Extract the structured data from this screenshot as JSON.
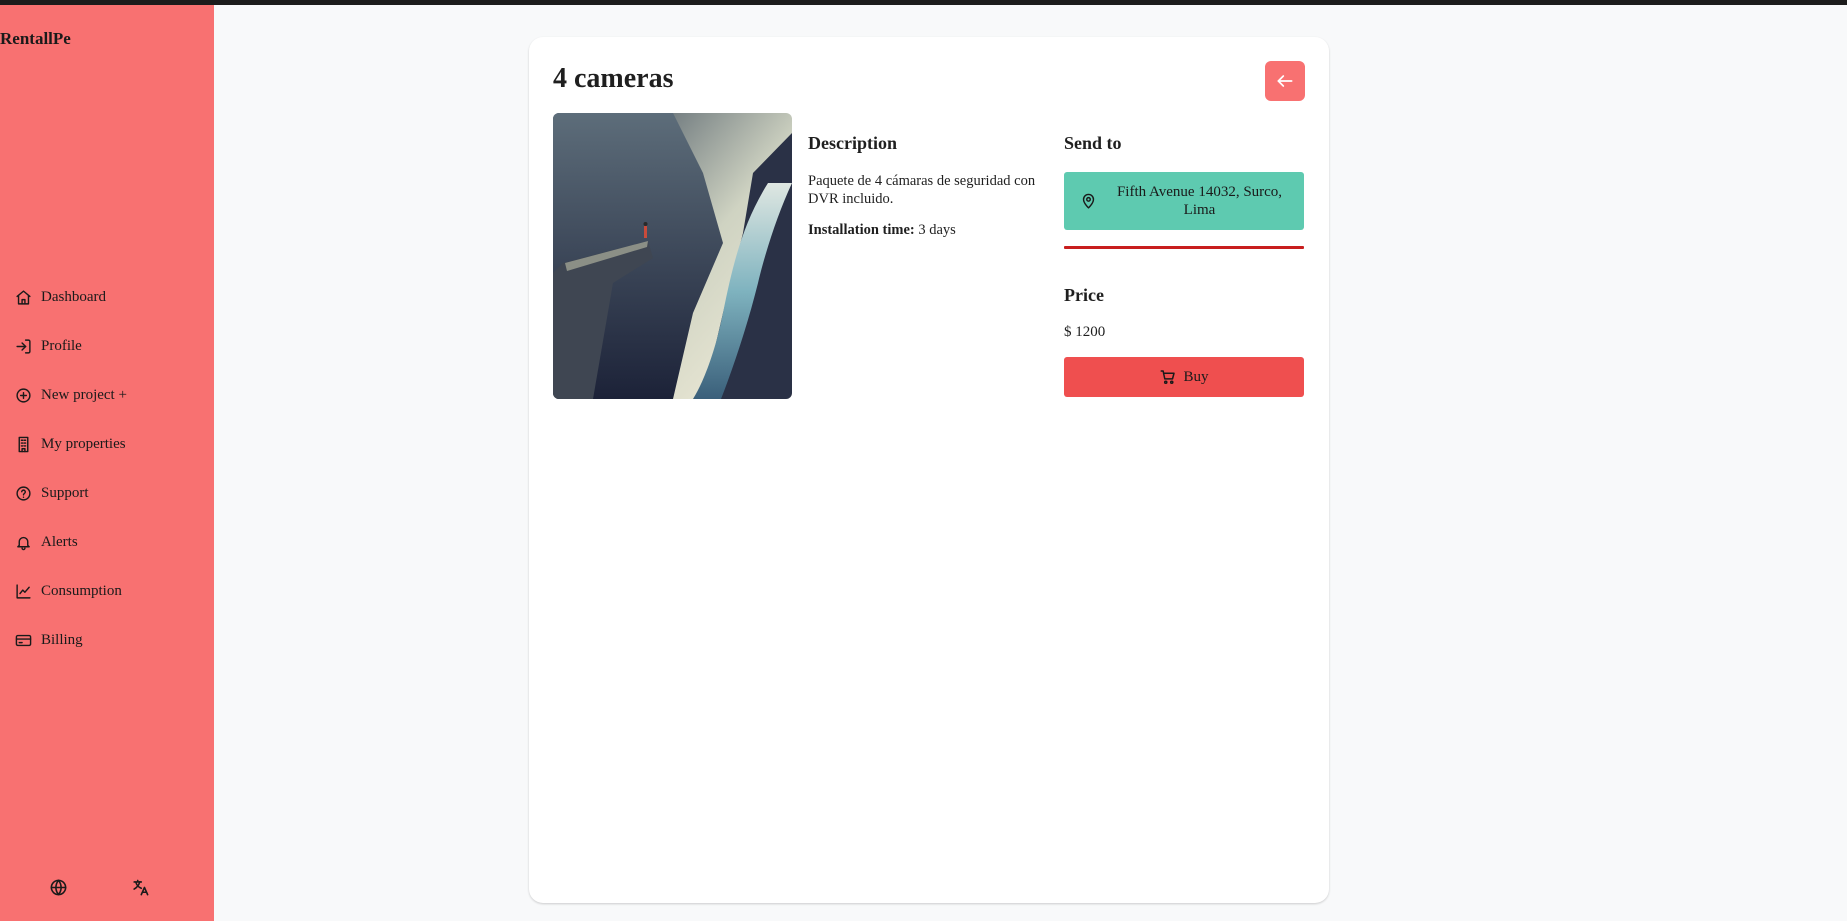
{
  "app": {
    "brand": "RentallPe"
  },
  "sidebar": {
    "items": [
      {
        "label": "Dashboard",
        "icon": "home-icon"
      },
      {
        "label": "Profile",
        "icon": "sign-in-icon"
      },
      {
        "label": "New project +",
        "icon": "plus-circle-icon"
      },
      {
        "label": "My properties",
        "icon": "building-icon"
      },
      {
        "label": "Support",
        "icon": "help-circle-icon"
      },
      {
        "label": "Alerts",
        "icon": "bell-icon"
      },
      {
        "label": "Consumption",
        "icon": "chart-line-icon"
      },
      {
        "label": "Billing",
        "icon": "credit-card-icon"
      }
    ],
    "footer": {
      "globe_icon": "globe-icon",
      "translate_icon": "translate-icon"
    }
  },
  "product": {
    "title": "4 cameras",
    "image_alt": "Cliff overlooking a fjord",
    "description_title": "Description",
    "description": "Paquete de 4 cámaras de seguridad con DVR incluido.",
    "installation_label": "Installation time:",
    "installation_value": "3 days",
    "send_to_title": "Send to",
    "address": "Fifth Avenue 14032, Surco, Lima",
    "price_title": "Price",
    "price": "$ 1200",
    "buy_label": "Buy"
  },
  "colors": {
    "sidebar": "#f87171",
    "address_button": "#5ecab0",
    "buy_button": "#ef4f4f",
    "divider": "#c81e1e"
  }
}
